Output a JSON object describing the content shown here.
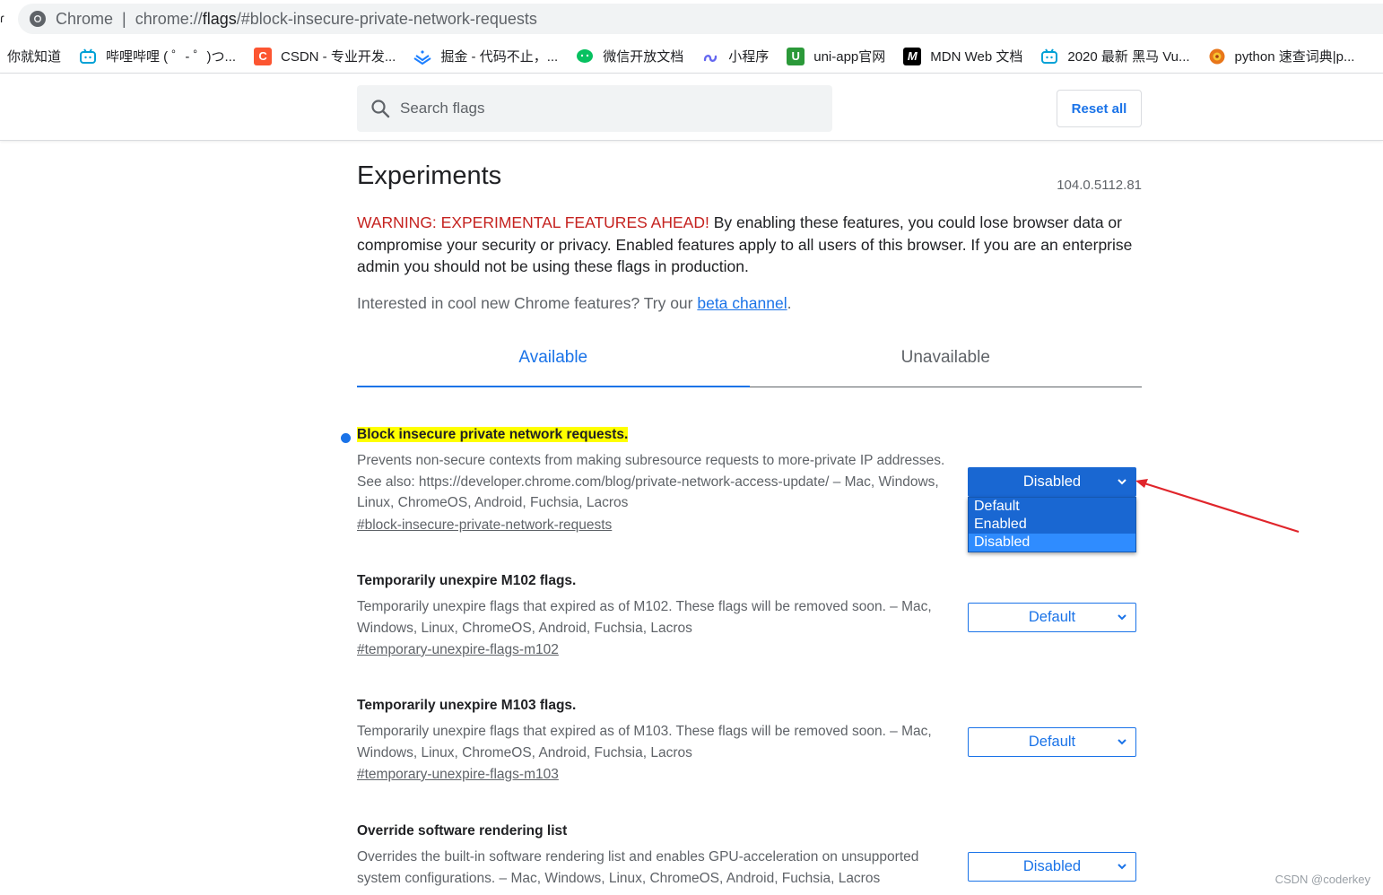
{
  "omnibox": {
    "site_label": "Chrome",
    "separator": "|",
    "url_prefix": "chrome://",
    "url_host": "flags",
    "url_rest": "/#block-insecure-private-network-requests"
  },
  "bookmarks": [
    {
      "label": "你就知道",
      "icon": "none"
    },
    {
      "label": "哔哩哔哩 ( ゜- ゜)つ...",
      "icon": "bilibili-icon"
    },
    {
      "label": "CSDN - 专业开发...",
      "icon": "csdn-icon"
    },
    {
      "label": "掘金 - 代码不止，...",
      "icon": "juejin-icon"
    },
    {
      "label": "微信开放文档",
      "icon": "wechat-icon"
    },
    {
      "label": "小程序",
      "icon": "miniprogram-icon"
    },
    {
      "label": "uni-app官网",
      "icon": "uniapp-icon"
    },
    {
      "label": "MDN Web 文档",
      "icon": "mdn-icon"
    },
    {
      "label": "2020 最新 黑马 Vu...",
      "icon": "bilibili-icon"
    },
    {
      "label": "python 速查词典|p...",
      "icon": "python-icon"
    }
  ],
  "header": {
    "search_placeholder": "Search flags",
    "reset_label": "Reset all"
  },
  "main": {
    "title": "Experiments",
    "version": "104.0.5112.81",
    "warning_lead": "WARNING: EXPERIMENTAL FEATURES AHEAD!",
    "warning_body": " By enabling these features, you could lose browser data or compromise your security or privacy. Enabled features apply to all users of this browser. If you are an enterprise admin you should not be using these flags in production.",
    "interest_text": "Interested in cool new Chrome features? Try our ",
    "interest_link": "beta channel",
    "interest_end": ".",
    "tabs": [
      {
        "label": "Available",
        "active": true
      },
      {
        "label": "Unavailable",
        "active": false
      }
    ]
  },
  "experiments": [
    {
      "title": "Block insecure private network requests.",
      "description": "Prevents non-secure contexts from making subresource requests to more-private IP addresses. See also: https://developer.chrome.com/blog/private-network-access-update/ – Mac, Windows, Linux, ChromeOS, Android, Fuchsia, Lacros",
      "link": "#block-insecure-private-network-requests",
      "value": "Disabled",
      "highlighted": true,
      "dropdown_open": true,
      "options": [
        "Default",
        "Enabled",
        "Disabled"
      ]
    },
    {
      "title": "Temporarily unexpire M102 flags.",
      "description": "Temporarily unexpire flags that expired as of M102. These flags will be removed soon. – Mac, Windows, Linux, ChromeOS, Android, Fuchsia, Lacros",
      "link": "#temporary-unexpire-flags-m102",
      "value": "Default"
    },
    {
      "title": "Temporarily unexpire M103 flags.",
      "description": "Temporarily unexpire flags that expired as of M103. These flags will be removed soon. – Mac, Windows, Linux, ChromeOS, Android, Fuchsia, Lacros",
      "link": "#temporary-unexpire-flags-m103",
      "value": "Default"
    },
    {
      "title": "Override software rendering list",
      "description": "Overrides the built-in software rendering list and enables GPU-acceleration on unsupported system configurations. – Mac, Windows, Linux, ChromeOS, Android, Fuchsia, Lacros",
      "value": "Disabled"
    }
  ],
  "watermark": "CSDN @coderkey",
  "colors": {
    "accent": "#1a73e8",
    "warning": "#c5221f",
    "highlight": "#ffff00",
    "annotation_arrow": "#e0252b"
  }
}
